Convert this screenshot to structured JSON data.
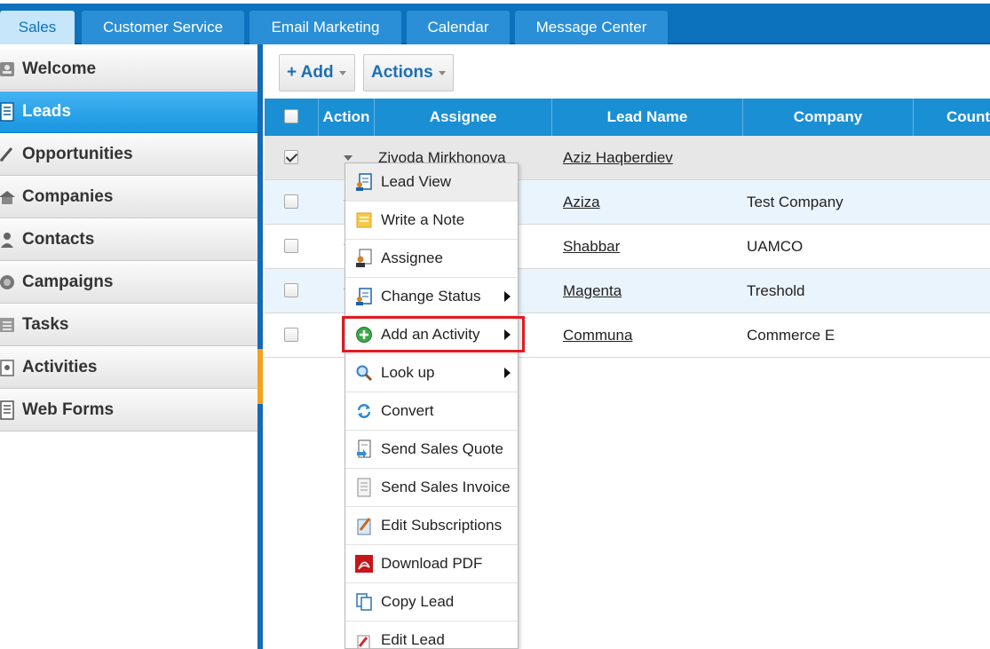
{
  "tabs": [
    {
      "label": "Sales",
      "active": true
    },
    {
      "label": "Customer Service",
      "active": false
    },
    {
      "label": "Email Marketing",
      "active": false
    },
    {
      "label": "Calendar",
      "active": false
    },
    {
      "label": "Message Center",
      "active": false
    }
  ],
  "sidebar": {
    "items": [
      {
        "label": "Welcome",
        "icon": "welcome-icon",
        "active": false
      },
      {
        "label": "Leads",
        "icon": "leads-icon",
        "active": true
      },
      {
        "label": "Opportunities",
        "icon": "opportunities-icon",
        "active": false
      },
      {
        "label": "Companies",
        "icon": "companies-icon",
        "active": false
      },
      {
        "label": "Contacts",
        "icon": "contacts-icon",
        "active": false
      },
      {
        "label": "Campaigns",
        "icon": "campaigns-icon",
        "active": false
      },
      {
        "label": "Tasks",
        "icon": "tasks-icon",
        "active": false
      },
      {
        "label": "Activities",
        "icon": "activities-icon",
        "active": false
      },
      {
        "label": "Web Forms",
        "icon": "web-forms-icon",
        "active": false
      }
    ]
  },
  "toolbar": {
    "add_label": "+ Add",
    "actions_label": "Actions"
  },
  "grid": {
    "headers": {
      "action": "Action",
      "assignee": "Assignee",
      "lead_name": "Lead Name",
      "company": "Company",
      "country": "Count"
    },
    "rows": [
      {
        "checked": true,
        "assignee": "Zivoda Mirkhonova",
        "lead_name": "Aziz Haqberdiev",
        "company": ""
      },
      {
        "checked": false,
        "assignee": "",
        "lead_name": "Aziza",
        "company": "Test Company"
      },
      {
        "checked": false,
        "assignee": "",
        "lead_name": "Shabbar",
        "company": "UAMCO"
      },
      {
        "checked": false,
        "assignee": "",
        "lead_name": "Magenta",
        "company": "Treshold"
      },
      {
        "checked": false,
        "assignee": "",
        "lead_name": "Communa",
        "company": "Commerce E"
      }
    ]
  },
  "context_menu": {
    "items": [
      {
        "label": "Lead View",
        "icon": "lead-view-icon",
        "submenu": false
      },
      {
        "label": "Write a Note",
        "icon": "note-icon",
        "submenu": false
      },
      {
        "label": "Assignee",
        "icon": "assignee-icon",
        "submenu": false
      },
      {
        "label": "Change Status",
        "icon": "change-status-icon",
        "submenu": true
      },
      {
        "label": "Add an Activity",
        "icon": "add-activity-icon",
        "submenu": true,
        "highlighted": true
      },
      {
        "label": "Look up",
        "icon": "look-up-icon",
        "submenu": true
      },
      {
        "label": "Convert",
        "icon": "convert-icon",
        "submenu": false
      },
      {
        "label": "Send Sales Quote",
        "icon": "sales-quote-icon",
        "submenu": false
      },
      {
        "label": "Send Sales Invoice",
        "icon": "sales-invoice-icon",
        "submenu": false
      },
      {
        "label": "Edit Subscriptions",
        "icon": "edit-subscriptions-icon",
        "submenu": false
      },
      {
        "label": "Download PDF",
        "icon": "pdf-icon",
        "submenu": false
      },
      {
        "label": "Copy Lead",
        "icon": "copy-icon",
        "submenu": false
      },
      {
        "label": "Edit Lead",
        "icon": "edit-icon",
        "submenu": false
      }
    ]
  },
  "colors": {
    "topbar": "#0d72bd",
    "active_tab": "#c7e6fa",
    "grid_header": "#1b8fd3",
    "sidebar_active": "#1896e0",
    "highlight_border": "#e01b22"
  }
}
